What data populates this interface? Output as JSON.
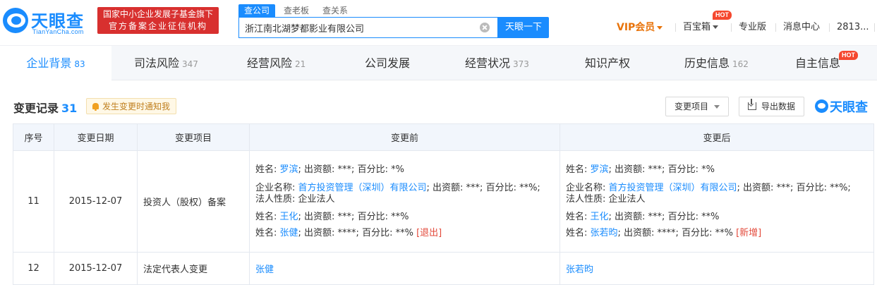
{
  "header": {
    "logo_cn": "天眼查",
    "logo_en": "TianYanCha.com",
    "gov_badge_line1": "国家中小企业发展子基金旗下",
    "gov_badge_line2": "官方备案企业征信机构",
    "search_tabs": [
      "查公司",
      "查老板",
      "查关系"
    ],
    "search_value": "浙江南北湖梦都影业有限公司",
    "search_button": "天眼一下",
    "vip_label": "VIP会员",
    "baibaoxiang": "百宝箱",
    "hot_badge": "HOT",
    "pro_label": "专业版",
    "msg_label": "消息中心",
    "user_label": "2813..."
  },
  "nav": {
    "tabs": [
      {
        "label": "企业背景",
        "count": "83"
      },
      {
        "label": "司法风险",
        "count": "347"
      },
      {
        "label": "经营风险",
        "count": "21"
      },
      {
        "label": "公司发展",
        "count": ""
      },
      {
        "label": "经营状况",
        "count": "373"
      },
      {
        "label": "知识产权",
        "count": ""
      },
      {
        "label": "历史信息",
        "count": "162"
      },
      {
        "label": "自主信息",
        "count": ""
      }
    ],
    "hot_badge": "HOT"
  },
  "section": {
    "title": "变更记录",
    "count": "31",
    "notify_label": "发生变更时通知我",
    "filter_label": "变更项目",
    "export_label": "导出数据",
    "brand": "天眼查"
  },
  "table": {
    "headers": [
      "序号",
      "变更日期",
      "变更项目",
      "变更前",
      "变更后"
    ],
    "rows": [
      {
        "no": "11",
        "date": "2015-12-07",
        "item": "投资人（股权）备案",
        "before": {
          "l1": {
            "a": "姓名: ",
            "name": "罗滨",
            "b": "; 出资额: ***; 百分比: *%"
          },
          "l2": {
            "a": "企业名称: ",
            "name": "首方投资管理（深圳）有限公司",
            "b": "; 出资额: ***; 百分比: **%;"
          },
          "l3": "法人性质: 企业法人",
          "l4": {
            "a": "姓名: ",
            "name": "王化",
            "b": "; 出资额: ***; 百分比: **%"
          },
          "l5": {
            "a": "姓名: ",
            "name": "张健",
            "b": "; 出资额: ****; 百分比: **% ",
            "tag": "[退出]"
          }
        },
        "after": {
          "l1": {
            "a": "姓名: ",
            "name": "罗滨",
            "b": "; 出资额: ***; 百分比: *%"
          },
          "l2": {
            "a": "企业名称: ",
            "name": "首方投资管理（深圳）有限公司",
            "b": "; 出资额: ***; 百分比: **%;"
          },
          "l3": "法人性质: 企业法人",
          "l4": {
            "a": "姓名: ",
            "name": "王化",
            "b": "; 出资额: ***; 百分比: **%"
          },
          "l5": {
            "a": "姓名: ",
            "name": "张若昀",
            "b": "; 出资额: ****; 百分比: **% ",
            "tag": "[新增]"
          }
        }
      },
      {
        "no": "12",
        "date": "2015-12-07",
        "item": "法定代表人变更",
        "before": "张健",
        "after": "张若昀"
      }
    ]
  }
}
